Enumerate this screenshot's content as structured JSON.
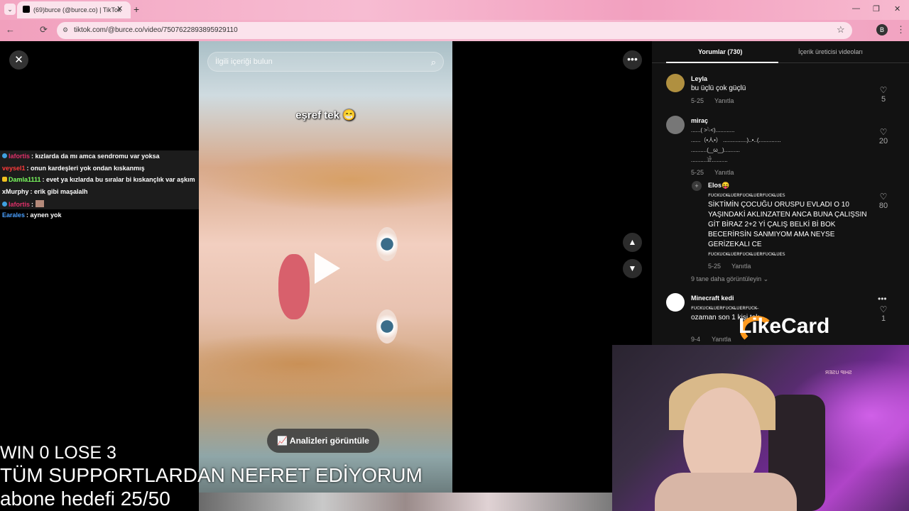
{
  "browser": {
    "tab_title": "(69)burce (@burce.co) | TikTok",
    "url": "tiktok.com/@burce.co/video/7507622893895929110",
    "profile_initial": "B",
    "icons": {
      "back": "←",
      "reload": "⟳",
      "minimize": "—",
      "maximize": "❐",
      "close": "✕",
      "new_tab": "+",
      "tab_close": "✕",
      "menu": "⋮",
      "star": "☆"
    }
  },
  "chat": [
    {
      "user": "lafortis",
      "user_color": "#e0306a",
      "msg": ": kızlarda da mı amca sendromu var yoksa",
      "badges": true
    },
    {
      "user": "veysel1",
      "user_color": "#ff3b3b",
      "msg": ": onun kardeşleri yok ondan kıskanmış",
      "badges": false
    },
    {
      "user": "Damla1111",
      "user_color": "#7cff60",
      "msg": ": evet ya kızlarda bu sıralar bi kıskançlık var aşkım",
      "badges": true
    },
    {
      "user": "xMurphy",
      "user_color": "#ffffff",
      "msg": ": erik gibi maşalalh",
      "badges": false
    },
    {
      "user": "lafortis",
      "user_color": "#e0306a",
      "msg": ":",
      "badges": true
    },
    {
      "user": "Earales",
      "user_color": "#4aa0ff",
      "msg": ": aynen yok",
      "badges": false
    }
  ],
  "video": {
    "search_placeholder": "İlgili içeriği bulun",
    "caption": "eşref tek 😁",
    "analytics_label": "Analizleri görüntüle"
  },
  "comments_panel": {
    "tab_comments": "Yorumlar (730)",
    "tab_creator": "İçerik üreticisi videoları",
    "comments": [
      {
        "user": "Leyla",
        "text": "bu üçlü çok güçlü",
        "date": "5-25",
        "reply": "Yanıtla",
        "likes": "5"
      },
      {
        "user": "miraç",
        "lines": [
          "......( >𓆩<)............",
          "......（•人•）  ...............)..•..(..............",
          "..........(‿ω‿)..........",
          "..........𓀀.........."
        ],
        "date": "5-25",
        "reply": "Yanıtla",
        "likes": "20"
      },
      {
        "user": "Elos😝",
        "text": "SİKTİMİN ÇOCUĞU ORUSPU EVLADI O 10 YAŞINDAKİ AKLINZATEN ANCA BUNA ÇALIŞSIN GİT BİRAZ 2+2 Yİ ÇALIŞ BELKİ Bİ BOK BECERİRSİN SANMIYOM AMA NEYSE GERİZEKALI CE",
        "deco": "ꜰᴜᴄᴋᴜᴄᴋ̶ʟᴜᴇʀꜰᴜᴄᴋ̶ʟᴜᴇʀꜰᴜᴄᴋ̶ʟᴜᴇꜱ",
        "date": "5-25",
        "reply": "Yanıtla",
        "likes": "80"
      },
      {
        "more": "9 tane daha görüntüleyin"
      },
      {
        "user": "Minecraft kedi",
        "text": "ozaman son 1 kişi tek",
        "deco": "ꜰᴜᴄᴋᴜᴄᴋ̶ʟᴜᴇʀꜰᴜᴄᴋ̶ʟᴜᴇʀꜰᴜᴄᴋ̶",
        "date": "9-4",
        "reply": "Yanıtla",
        "likes": "1"
      }
    ]
  },
  "overlay": {
    "score": "WIN 0 LOSE 3",
    "banner": "TÜM SUPPORTLARDAN NEFRET EDİYORUM",
    "sub_goal": "abone hedefi 25/50",
    "sponsor": "LikeCard",
    "cam_sign": "SHIP USER"
  }
}
